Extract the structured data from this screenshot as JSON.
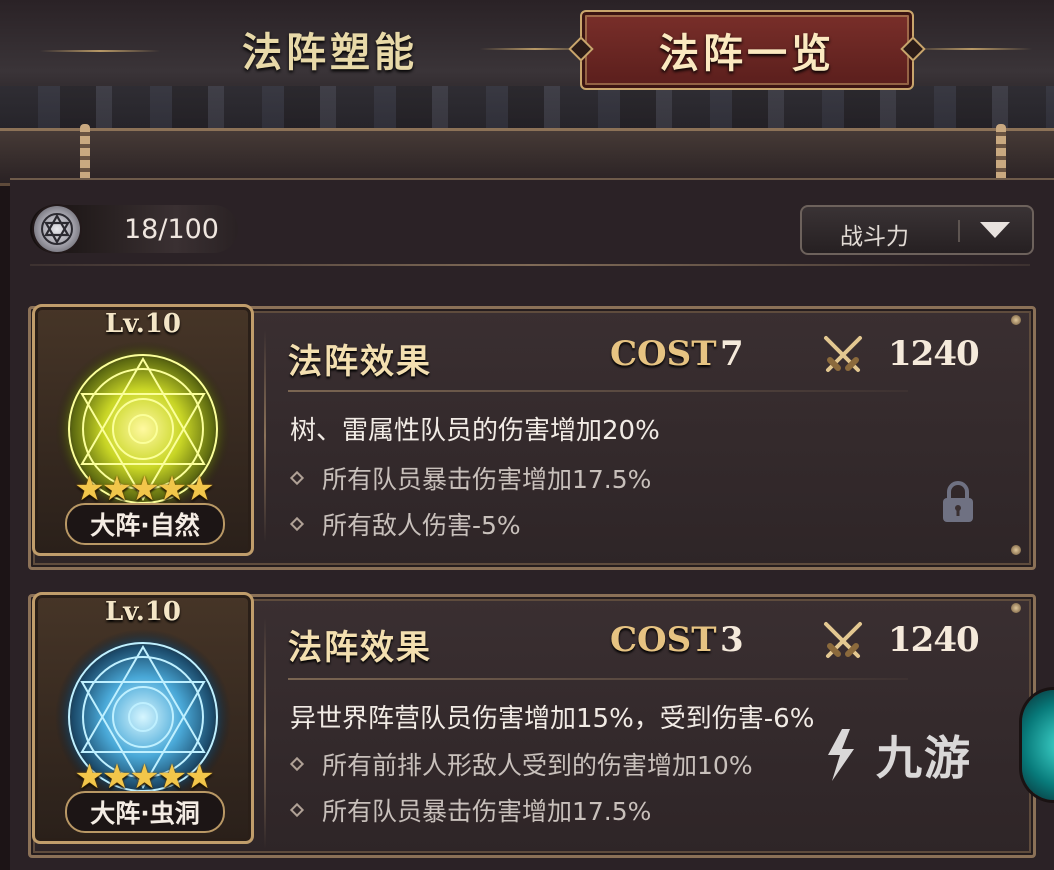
{
  "header": {
    "tab_left": "法阵塑能",
    "tab_active": "法阵一览"
  },
  "toolbar": {
    "count": "18/100",
    "sort_label": "战斗力"
  },
  "cards": [
    {
      "level": "Lv.10",
      "stars": "★★★★★",
      "type_label": "大阵·自然",
      "effect_title": "法阵效果",
      "cost_label": "COST",
      "cost_value": "7",
      "power": "1240",
      "main_effect": "树、雷属性队员的伤害增加20%",
      "sub_effects": [
        "所有队员暴击伤害增加17.5%",
        "所有敌人伤害-5%"
      ],
      "glow_color": "#e8f24a"
    },
    {
      "level": "Lv.10",
      "stars": "★★★★★",
      "type_label": "大阵·虫洞",
      "effect_title": "法阵效果",
      "cost_label": "COST",
      "cost_value": "3",
      "power": "1240",
      "main_effect": "异世界阵营队员伤害增加15%，受到伤害-6%",
      "sub_effects": [
        "所有前排人形敌人受到的伤害增加10%",
        "所有队员暴击伤害增加17.5%"
      ],
      "glow_color": "#7fd8ff"
    }
  ],
  "watermark": "九游"
}
